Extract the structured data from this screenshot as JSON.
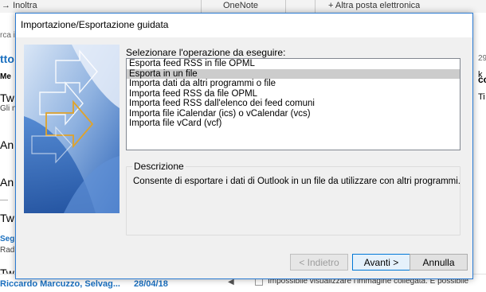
{
  "background": {
    "toolbar": [
      "Inoltra",
      "OneNote",
      "Altra posta elettronica"
    ],
    "left_rows": [
      "rca i",
      "tto",
      "Me",
      "Tw",
      "Gli n",
      "An",
      "An",
      "Tw",
      "Seg",
      "Rad",
      "Tw"
    ],
    "sender": "Riccardo Marcuzzo, Selvag...",
    "date": "28/04/18",
    "right_rows": [
      "29",
      "k",
      "cc",
      "Ti"
    ],
    "bottom_text": "Impossibile visualizzare l'immagine collegata. È possibile che il f"
  },
  "dialog": {
    "title": "Importazione/Esportazione guidata",
    "operation_label": "Selezionare l'operazione da eseguire:",
    "operations": [
      "Esporta feed RSS in file OPML",
      "Esporta in un file",
      "Importa dati da altri programmi o file",
      "Importa feed RSS da file OPML",
      "Importa feed RSS dall'elenco dei feed comuni",
      "Importa file iCalendar (ics) o vCalendar (vcs)",
      "Importa file vCard (vcf)"
    ],
    "selected_index": 1,
    "description_label": "Descrizione",
    "description_text": "Consente di esportare i dati di Outlook in un file da utilizzare con altri programmi.",
    "buttons": {
      "back": "< Indietro",
      "next": "Avanti >",
      "cancel": "Annulla"
    }
  },
  "colors": {
    "accent": "#2b7bd3",
    "selection": "#cccccc",
    "dialog_bg": "#f0f0f0"
  }
}
